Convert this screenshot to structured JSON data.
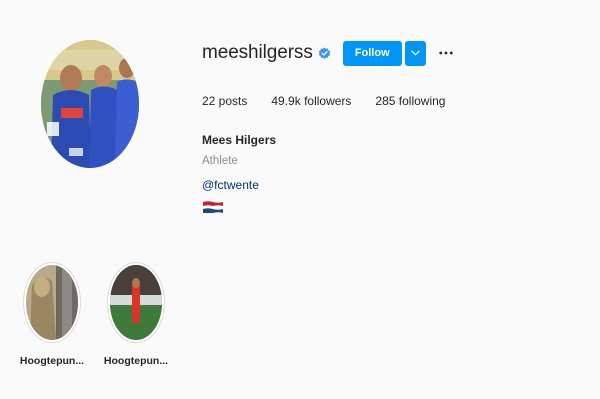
{
  "profile": {
    "username": "meeshilgerss",
    "verified": true,
    "follow_label": "Follow",
    "stats": {
      "posts": "22 posts",
      "followers": "49.9k followers",
      "following": "285 following"
    },
    "full_name": "Mees Hilgers",
    "category": "Athlete",
    "bio_link": "@fctwente",
    "flag": "netherlands-flag"
  },
  "highlights": [
    {
      "label": "Hoogtepun..."
    },
    {
      "label": "Hoogtepun..."
    }
  ],
  "colors": {
    "accent": "#0095f6",
    "link": "#00376b",
    "muted": "#8e8e8e",
    "background": "#fafafa"
  }
}
